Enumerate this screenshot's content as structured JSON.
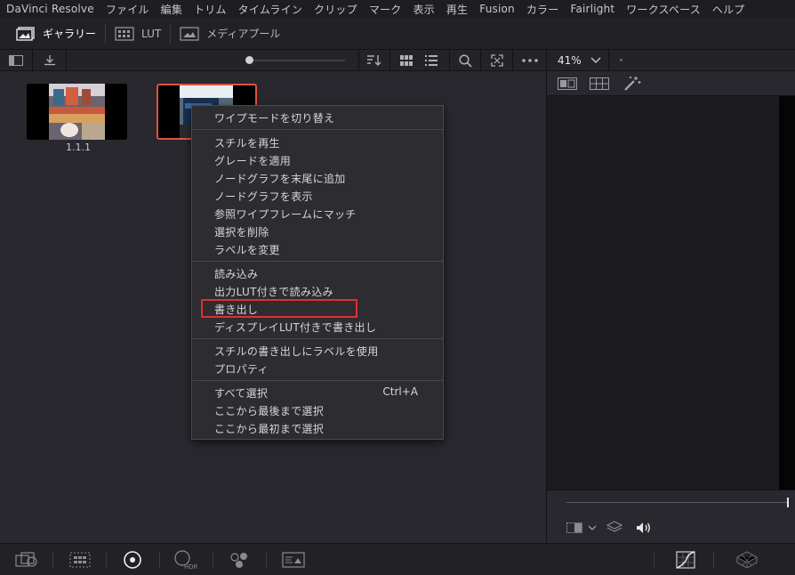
{
  "menubar": {
    "items": [
      "DaVinci Resolve",
      "ファイル",
      "編集",
      "トリム",
      "タイムライン",
      "クリップ",
      "マーク",
      "表示",
      "再生",
      "Fusion",
      "カラー",
      "Fairlight",
      "ワークスペース",
      "ヘルプ"
    ]
  },
  "toolbar": {
    "gallery_label": "ギャラリー",
    "lut_label": "LUT",
    "media_pool_label": "メディアプール"
  },
  "gallery": {
    "stills": [
      {
        "label": "1.1.1",
        "selected": false
      },
      {
        "label": "",
        "selected": true
      }
    ],
    "accent_color": "#e0533e"
  },
  "viewer": {
    "zoom": "41%"
  },
  "context_menu": {
    "groups": [
      [
        {
          "label": "ワイプモードを切り替え"
        }
      ],
      [
        {
          "label": "スチルを再生"
        },
        {
          "label": "グレードを適用"
        },
        {
          "label": "ノードグラフを末尾に追加"
        },
        {
          "label": "ノードグラフを表示"
        },
        {
          "label": "参照ワイプフレームにマッチ"
        },
        {
          "label": "選択を削除"
        },
        {
          "label": "ラベルを変更"
        }
      ],
      [
        {
          "label": "読み込み"
        },
        {
          "label": "出力LUT付きで読み込み"
        },
        {
          "label": "書き出し",
          "highlighted": true
        },
        {
          "label": "ディスプレイLUT付きで書き出し"
        }
      ],
      [
        {
          "label": "スチルの書き出しにラベルを使用"
        },
        {
          "label": "プロパティ"
        }
      ],
      [
        {
          "label": "すべて選択",
          "shortcut": "Ctrl+A"
        },
        {
          "label": "ここから最後まで選択"
        },
        {
          "label": "ここから最初まで選択"
        }
      ]
    ],
    "highlight_color": "#e03030"
  },
  "icons": {
    "toolbar": [
      "gallery-icon",
      "lut-icon",
      "media-pool-icon"
    ],
    "gallery_header": [
      "sidebar-toggle-icon",
      "download-icon",
      "sort-icon",
      "grid-view-icon",
      "list-view-icon",
      "search-icon",
      "expand-icon",
      "more-icon"
    ],
    "viewer": [
      "chevron-down-icon",
      "split-view-icon",
      "grid-view-icon",
      "magic-wand-icon",
      "layers-icon",
      "speaker-icon"
    ],
    "bottombar": [
      "color-wheels-icon",
      "qualifier-icon",
      "tracker-icon",
      "hdr-icon",
      "rgb-mixer-icon",
      "motion-effects-icon",
      "curves-icon",
      "3d-lut-icon"
    ]
  }
}
